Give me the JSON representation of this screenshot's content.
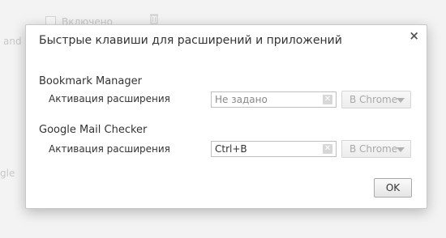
{
  "background": {
    "enabled_label": "Включено",
    "and_fragment": "and",
    "gle_fragment": "gle"
  },
  "dialog": {
    "title": "Быстрые клавиши для расширений и приложений",
    "close_label": "×",
    "ok_label": "OK",
    "extensions": [
      {
        "name": "Bookmark Manager",
        "command": "Активация расширения",
        "shortcut_value": "",
        "shortcut_placeholder": "Не задано",
        "scope": "В Chrome"
      },
      {
        "name": "Google Mail Checker",
        "command": "Активация расширения",
        "shortcut_value": "Ctrl+B",
        "shortcut_placeholder": "",
        "scope": "В Chrome"
      }
    ]
  }
}
